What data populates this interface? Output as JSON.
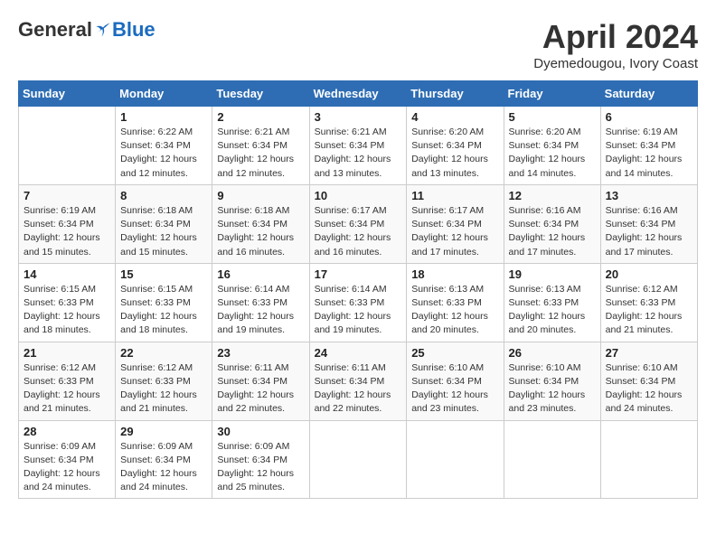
{
  "header": {
    "logo_general": "General",
    "logo_blue": "Blue",
    "month_title": "April 2024",
    "location": "Dyemedougou, Ivory Coast"
  },
  "weekdays": [
    "Sunday",
    "Monday",
    "Tuesday",
    "Wednesday",
    "Thursday",
    "Friday",
    "Saturday"
  ],
  "weeks": [
    [
      {
        "day": "",
        "info": ""
      },
      {
        "day": "1",
        "info": "Sunrise: 6:22 AM\nSunset: 6:34 PM\nDaylight: 12 hours\nand 12 minutes."
      },
      {
        "day": "2",
        "info": "Sunrise: 6:21 AM\nSunset: 6:34 PM\nDaylight: 12 hours\nand 12 minutes."
      },
      {
        "day": "3",
        "info": "Sunrise: 6:21 AM\nSunset: 6:34 PM\nDaylight: 12 hours\nand 13 minutes."
      },
      {
        "day": "4",
        "info": "Sunrise: 6:20 AM\nSunset: 6:34 PM\nDaylight: 12 hours\nand 13 minutes."
      },
      {
        "day": "5",
        "info": "Sunrise: 6:20 AM\nSunset: 6:34 PM\nDaylight: 12 hours\nand 14 minutes."
      },
      {
        "day": "6",
        "info": "Sunrise: 6:19 AM\nSunset: 6:34 PM\nDaylight: 12 hours\nand 14 minutes."
      }
    ],
    [
      {
        "day": "7",
        "info": "Sunrise: 6:19 AM\nSunset: 6:34 PM\nDaylight: 12 hours\nand 15 minutes."
      },
      {
        "day": "8",
        "info": "Sunrise: 6:18 AM\nSunset: 6:34 PM\nDaylight: 12 hours\nand 15 minutes."
      },
      {
        "day": "9",
        "info": "Sunrise: 6:18 AM\nSunset: 6:34 PM\nDaylight: 12 hours\nand 16 minutes."
      },
      {
        "day": "10",
        "info": "Sunrise: 6:17 AM\nSunset: 6:34 PM\nDaylight: 12 hours\nand 16 minutes."
      },
      {
        "day": "11",
        "info": "Sunrise: 6:17 AM\nSunset: 6:34 PM\nDaylight: 12 hours\nand 17 minutes."
      },
      {
        "day": "12",
        "info": "Sunrise: 6:16 AM\nSunset: 6:34 PM\nDaylight: 12 hours\nand 17 minutes."
      },
      {
        "day": "13",
        "info": "Sunrise: 6:16 AM\nSunset: 6:34 PM\nDaylight: 12 hours\nand 17 minutes."
      }
    ],
    [
      {
        "day": "14",
        "info": "Sunrise: 6:15 AM\nSunset: 6:33 PM\nDaylight: 12 hours\nand 18 minutes."
      },
      {
        "day": "15",
        "info": "Sunrise: 6:15 AM\nSunset: 6:33 PM\nDaylight: 12 hours\nand 18 minutes."
      },
      {
        "day": "16",
        "info": "Sunrise: 6:14 AM\nSunset: 6:33 PM\nDaylight: 12 hours\nand 19 minutes."
      },
      {
        "day": "17",
        "info": "Sunrise: 6:14 AM\nSunset: 6:33 PM\nDaylight: 12 hours\nand 19 minutes."
      },
      {
        "day": "18",
        "info": "Sunrise: 6:13 AM\nSunset: 6:33 PM\nDaylight: 12 hours\nand 20 minutes."
      },
      {
        "day": "19",
        "info": "Sunrise: 6:13 AM\nSunset: 6:33 PM\nDaylight: 12 hours\nand 20 minutes."
      },
      {
        "day": "20",
        "info": "Sunrise: 6:12 AM\nSunset: 6:33 PM\nDaylight: 12 hours\nand 21 minutes."
      }
    ],
    [
      {
        "day": "21",
        "info": "Sunrise: 6:12 AM\nSunset: 6:33 PM\nDaylight: 12 hours\nand 21 minutes."
      },
      {
        "day": "22",
        "info": "Sunrise: 6:12 AM\nSunset: 6:33 PM\nDaylight: 12 hours\nand 21 minutes."
      },
      {
        "day": "23",
        "info": "Sunrise: 6:11 AM\nSunset: 6:34 PM\nDaylight: 12 hours\nand 22 minutes."
      },
      {
        "day": "24",
        "info": "Sunrise: 6:11 AM\nSunset: 6:34 PM\nDaylight: 12 hours\nand 22 minutes."
      },
      {
        "day": "25",
        "info": "Sunrise: 6:10 AM\nSunset: 6:34 PM\nDaylight: 12 hours\nand 23 minutes."
      },
      {
        "day": "26",
        "info": "Sunrise: 6:10 AM\nSunset: 6:34 PM\nDaylight: 12 hours\nand 23 minutes."
      },
      {
        "day": "27",
        "info": "Sunrise: 6:10 AM\nSunset: 6:34 PM\nDaylight: 12 hours\nand 24 minutes."
      }
    ],
    [
      {
        "day": "28",
        "info": "Sunrise: 6:09 AM\nSunset: 6:34 PM\nDaylight: 12 hours\nand 24 minutes."
      },
      {
        "day": "29",
        "info": "Sunrise: 6:09 AM\nSunset: 6:34 PM\nDaylight: 12 hours\nand 24 minutes."
      },
      {
        "day": "30",
        "info": "Sunrise: 6:09 AM\nSunset: 6:34 PM\nDaylight: 12 hours\nand 25 minutes."
      },
      {
        "day": "",
        "info": ""
      },
      {
        "day": "",
        "info": ""
      },
      {
        "day": "",
        "info": ""
      },
      {
        "day": "",
        "info": ""
      }
    ]
  ]
}
